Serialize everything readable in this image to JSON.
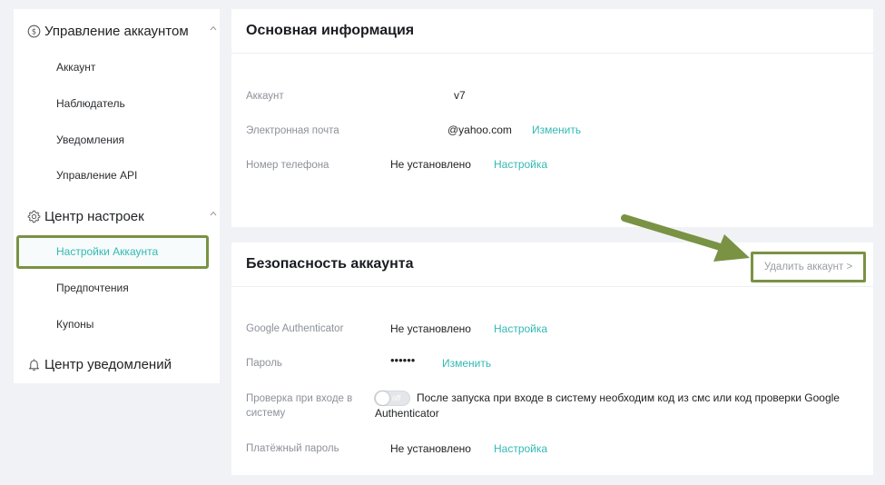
{
  "sidebar": {
    "account_management": {
      "title": "Управление аккаунтом",
      "items": [
        "Аккаунт",
        "Наблюдатель",
        "Уведомления",
        "Управление API"
      ]
    },
    "settings_center": {
      "title": "Центр настроек",
      "items": [
        "Настройки Аккаунта",
        "Предпочтения",
        "Купоны"
      ],
      "active_item": "Настройки Аккаунта"
    },
    "notifications_center": {
      "title": "Центр уведомлений"
    }
  },
  "basic_info": {
    "title": "Основная информация",
    "account_label": "Аккаунт",
    "account_value": "v7",
    "email_label": "Электронная почта",
    "email_value": "@yahoo.com",
    "email_action": "Изменить",
    "phone_label": "Номер телефона",
    "phone_value": "Не установлено",
    "phone_action": "Настройка"
  },
  "security": {
    "title": "Безопасность аккаунта",
    "delete_account": "Удалить аккаунт >",
    "ga_label": "Google Authenticator",
    "ga_value": "Не установлено",
    "ga_action": "Настройка",
    "password_label": "Пароль",
    "password_value": "••••••",
    "password_action": "Изменить",
    "login_check_label": "Проверка при входе в систему",
    "login_check_toggle": "off",
    "login_check_note": "После запуска при входе в систему необходим код из смс или код проверки Google Authenticator",
    "payment_password_label": "Платёжный пароль",
    "payment_password_value": "Не установлено",
    "payment_password_action": "Настройка"
  },
  "colors": {
    "accent": "#33b9b4",
    "highlight_border": "#7a9244",
    "arrow": "#7a9244"
  }
}
